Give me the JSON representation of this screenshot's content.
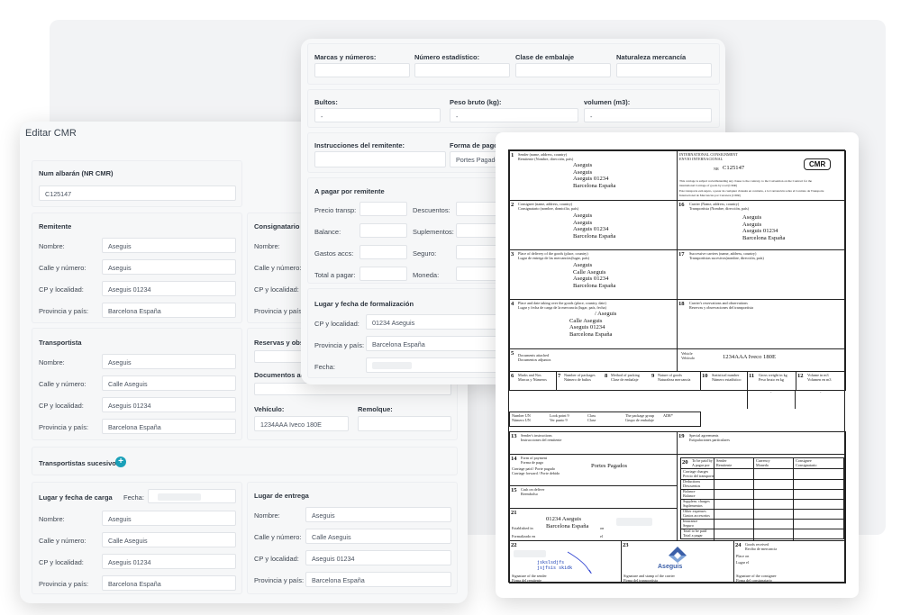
{
  "editor": {
    "title": "Editar CMR",
    "albaran_label": "Num albarán (NR CMR)",
    "albaran_value": "C125147",
    "remitente": {
      "heading": "Remitente",
      "fields": [
        {
          "label": "Nombre:",
          "value": "Aseguis"
        },
        {
          "label": "Calle y número:",
          "value": "Aseguis"
        },
        {
          "label": "CP y localidad:",
          "value": "Aseguis 01234"
        },
        {
          "label": "Provincia y país:",
          "value": "Barcelona España"
        }
      ]
    },
    "consignatario": {
      "heading": "Consignatario",
      "fields": [
        {
          "label": "Nombre:"
        },
        {
          "label": "Calle y número:"
        },
        {
          "label": "CP y localidad:"
        },
        {
          "label": "Provincia y país:"
        }
      ]
    },
    "transportista": {
      "heading": "Transportista",
      "fields": [
        {
          "label": "Nombre:",
          "value": "Aseguis"
        },
        {
          "label": "Calle y número:",
          "value": "Calle Aseguis"
        },
        {
          "label": "CP y localidad:",
          "value": "Aseguis 01234"
        },
        {
          "label": "Provincia y país:",
          "value": "Barcelona España"
        }
      ]
    },
    "reservas_label": "Reservas y obse",
    "documentos_label": "Documentos adj",
    "vehiculo_label": "Vehículo:",
    "vehiculo_value": "1234AAA Iveco 180E",
    "remolque_label": "Remolque:",
    "sucesivos_label": "Transportistas sucesivos",
    "plus_glyph": "+",
    "carga": {
      "heading": "Lugar y fecha de carga",
      "fecha_label": "Fecha:",
      "fields": [
        {
          "label": "Nombre:",
          "value": "Aseguis"
        },
        {
          "label": "Calle y número:",
          "value": "Calle Aseguis"
        },
        {
          "label": "CP y localidad:",
          "value": "Aseguis 01234"
        },
        {
          "label": "Provincia y país:",
          "value": "Barcelona España"
        }
      ]
    },
    "entrega": {
      "heading": "Lugar de entrega",
      "fields": [
        {
          "label": "Nombre:",
          "value": "Aseguis"
        },
        {
          "label": "Calle y número:",
          "value": "Calle Aseguis"
        },
        {
          "label": "CP y localidad:",
          "value": "Aseguis 01234"
        },
        {
          "label": "Provincia y país:",
          "value": "Barcelona España"
        }
      ]
    }
  },
  "goods": {
    "marcas_label": "Marcas y números:",
    "estadistico_label": "Número estadístico:",
    "embalaje_label": "Clase de embalaje",
    "naturaleza_label": "Naturaleza mercancía",
    "bultos_label": "Bultos:",
    "bultos_value": "-",
    "peso_label": "Peso bruto (kg):",
    "peso_value": "-",
    "volumen_label": "volumen (m3):",
    "volumen_value": "-",
    "instrucciones_label": "Instrucciones del remitente:",
    "forma_pago_label": "Forma de pago (I",
    "forma_pago_value": "Portes Pagados",
    "pagar_heading": "A pagar por remitente",
    "precio_label": "Precio transp:",
    "descuentos_label": "Descuentos:",
    "balance_label": "Balance:",
    "suplementos_label": "Suplementos:",
    "gastos_label": "Gastos accs:",
    "seguro_label": "Seguro:",
    "total_label": "Total a pagar:",
    "moneda_label": "Moneda:",
    "formalizacion_heading": "Lugar y fecha de formalización",
    "cp_label": "CP y localidad:",
    "cp_value": "01234 Aseguis",
    "provincia_label": "Provincia y país:",
    "provincia_value": "Barcelona España",
    "fecha_label": "Fecha:"
  },
  "cmr": {
    "badge": "CMR",
    "c1": {
      "num": "1",
      "t1": "Sender (name, address, country)",
      "t2": "Remitente (Nombre, dirección, país)",
      "lines": [
        "Aseguis",
        "Aseguis",
        "Aseguis 01234",
        "Barcelona España"
      ]
    },
    "header": {
      "t1": "INTERNATIONAL CONSIGNMENT",
      "t2": "ENVIO INTERNACIONAL",
      "nr": "NR",
      "number": "C125147",
      "n1": "This carriage is subject notwithstanding any clause to the contrary, to the Convention on the Contract for the",
      "n2": "international Carriage of goods by road (CMR)",
      "n3": "Este transporte está sujeto, a pesar de cualquier cláusula en contrario, a la Convención sobre el Contrato de Transporte",
      "n4": "Internacional de Mercancías por Carretera (CMR)"
    },
    "c2": {
      "num": "2",
      "t1": "Consignee (name, address, country)",
      "t2": "Consignatario (nombre, domicilio, país)",
      "lines": [
        "Aseguis",
        "Aseguis",
        "Aseguis 01234",
        "Barcelona España"
      ]
    },
    "c16": {
      "num": "16",
      "t1": "Carrier (Name, address, country)",
      "t2": "Transportista (Nombre, dirección, país)",
      "lines": [
        "Aseguis",
        "Aseguis",
        "Aseguis 01234",
        "Barcelona España"
      ]
    },
    "c3": {
      "num": "3",
      "t1": "Place of delivery of the goods (place, country)",
      "t2": "Lugar de entrega de las mercancías(lugar, país)",
      "lines": [
        "Aseguis",
        "Calle Aseguis",
        "Aseguis 01234",
        "Barcelona España"
      ]
    },
    "c17": {
      "num": "17",
      "t1": "Successive carriers (name, address, country)",
      "t2": "Transportistas sucesivos(nombre, dirección, país)"
    },
    "c4": {
      "num": "4",
      "t1": "Place and date taking over the goods (place, country, date)",
      "t2": "Lugar y fecha de carga de la mercancía (lugar, país, fecha)",
      "lines": [
        "/ Aseguis",
        "Calle Aseguis",
        "Aseguis 01234",
        "Barcelona España"
      ]
    },
    "c18": {
      "num": "18",
      "t1": "Carrier's reservations and observations",
      "t2": "Reservas y observaciones del transportista"
    },
    "c5": {
      "num": "5",
      "t1": "Documents attached",
      "t2": "Documentos adjuntos"
    },
    "vehicle": {
      "t1": "Vehicle",
      "t2": "Vehículo",
      "value": "1234AAA Iveco 180E"
    },
    "goods_cols": [
      {
        "num": "6",
        "t1": "Marks and Nos",
        "t2": "Marcas y Números"
      },
      {
        "num": "7",
        "t1": "Number of packages",
        "t2": "Número de bultos"
      },
      {
        "num": "8",
        "t1": "Method of packing",
        "t2": "Clase de embalaje"
      },
      {
        "num": "9",
        "t1": "Nature of goods",
        "t2": "Naturaleza mercancía"
      },
      {
        "num": "10",
        "t1": "Statistical number",
        "t2": "Número estadístico"
      },
      {
        "num": "11",
        "t1": "Gross weight in kg",
        "t2": "Peso bruto en kg"
      },
      {
        "num": "12",
        "t1": "Volume in m3",
        "t2": "Volumen en m3"
      }
    ],
    "dash": "-",
    "un": {
      "a1": "Number UN",
      "a2": "Número UN",
      "b1": "Look point 9",
      "b2": "Ver punto 9",
      "c1": "Class",
      "c2": "Clase",
      "d1": "The package group",
      "d2": "Grupo de embalaje",
      "e1": "ADR*"
    },
    "c13": {
      "num": "13",
      "t1": "Sender's instructions",
      "t2": "Instrucciones del remitente"
    },
    "c19": {
      "num": "19",
      "t1": "Special agreements",
      "t2": "Estipulaciones particulares"
    },
    "c14": {
      "num": "14",
      "t1": "Form of payment",
      "t2": "Forma de pago",
      "t3": "Carriage paid / Porte pagado",
      "t4": "Carriage forward / Porte debido",
      "value": "Portes Pagados"
    },
    "c20": {
      "num": "20",
      "t1": "To be paid by",
      "t2": "A pagar por",
      "cols": [
        "Sender",
        "Currency",
        "Consignee"
      ],
      "cols2": [
        "Remitente",
        "Moneda",
        "Consignatario"
      ],
      "rows": [
        "Carriage charges",
        "Precio del transporte",
        "Deductions",
        "Descuentos",
        "Balance",
        "Balance",
        "Supplem. charges",
        "Suplementos",
        "Other expenses",
        "Gastos accesorios",
        "Insurance",
        "Seguro",
        "Total to be paid",
        "Total a pagar"
      ]
    },
    "c15": {
      "num": "15",
      "t1": "Cash on deliver",
      "t2": "Reembolso"
    },
    "c21": {
      "num": "21",
      "t1": "Established in",
      "t2": "Formalizado en",
      "l1": "01234 Aseguis",
      "l2": "Barcelona España",
      "on": "on",
      "el": "el"
    },
    "c22": {
      "num": "22",
      "t1": "Signature of the sender",
      "t2": "Firma del remitente",
      "sig1": "jskslsdjfs",
      "sig2": "jsjfsis skidk"
    },
    "c23": {
      "num": "23",
      "t1": "Signature and stamp of the carrier",
      "t2": "Firma del transportista",
      "logo": "Aseguis"
    },
    "c24": {
      "num": "24",
      "t1": "Goods received",
      "t2": "Recibo de mercancía",
      "t3": "Place on",
      "t4": "Lugar el",
      "t5": "Signature of the consignee",
      "t6": "Firma del consignatario"
    }
  }
}
